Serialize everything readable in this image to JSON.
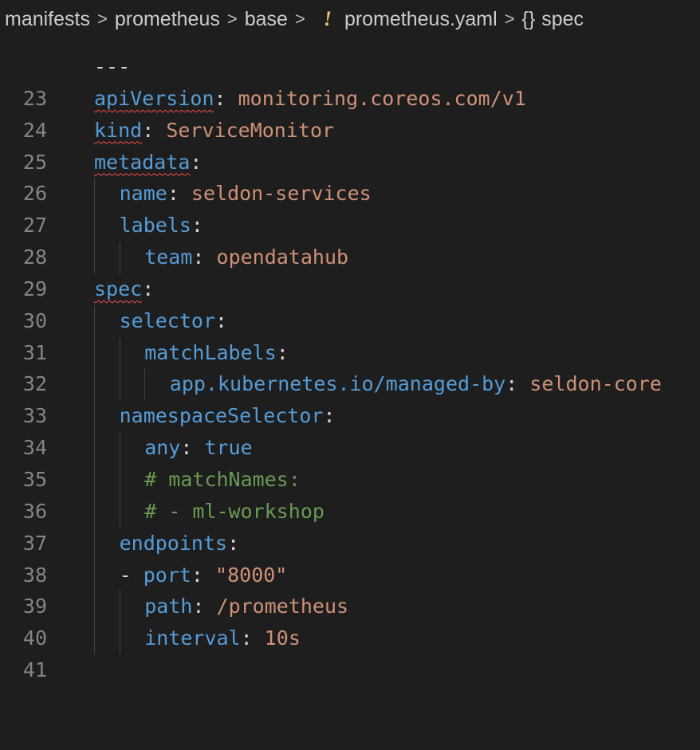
{
  "breadcrumb": {
    "items": [
      "manifests",
      "prometheus",
      "base"
    ],
    "file_icon": "!",
    "file": "prometheus.yaml",
    "symbol_icon": "{}",
    "symbol": "spec",
    "separator": ">"
  },
  "colors": {
    "background": "#1e1e1e",
    "key": "#569cd6",
    "string": "#ce9178",
    "line_number": "#858585",
    "error_squiggle": "#f14c4c"
  },
  "editor": {
    "lines": [
      {
        "num": "23",
        "text": "---"
      },
      {
        "num": "24",
        "key": "apiVersion",
        "colon": ":",
        "value": " monitoring.coreos.com/v1"
      },
      {
        "num": "25",
        "key": "kind",
        "colon": ":",
        "value": " ServiceMonitor"
      },
      {
        "num": "26",
        "key": "metadata",
        "colon": ":"
      },
      {
        "num": "27",
        "key": "name",
        "colon": ":",
        "value": " seldon-services"
      },
      {
        "num": "28",
        "key": "labels",
        "colon": ":"
      },
      {
        "num": "29",
        "key": "team",
        "colon": ":",
        "value": " opendatahub"
      },
      {
        "num": "30",
        "key": "spec",
        "colon": ":"
      },
      {
        "num": "31",
        "key": "selector",
        "colon": ":"
      },
      {
        "num": "32",
        "key": "matchLabels",
        "colon": ":"
      },
      {
        "num": "33",
        "key": "app.kubernetes.io/managed-by",
        "colon": ":",
        "value": " seldon-core"
      },
      {
        "num": "34",
        "key": "namespaceSelector",
        "colon": ":"
      },
      {
        "num": "35",
        "key": "any",
        "colon": ":",
        "value": " true"
      },
      {
        "num": "36",
        "comment": "# matchNames:"
      },
      {
        "num": "37",
        "comment": "# - ml-workshop"
      },
      {
        "num": "38",
        "key": "endpoints",
        "colon": ":"
      },
      {
        "num": "39",
        "dash": "- ",
        "key": "port",
        "colon": ":",
        "value": " \"8000\""
      },
      {
        "num": "40",
        "key": "path",
        "colon": ":",
        "value": " /prometheus"
      },
      {
        "num": "41",
        "key": "interval",
        "colon": ":",
        "value": " 10s"
      }
    ]
  }
}
